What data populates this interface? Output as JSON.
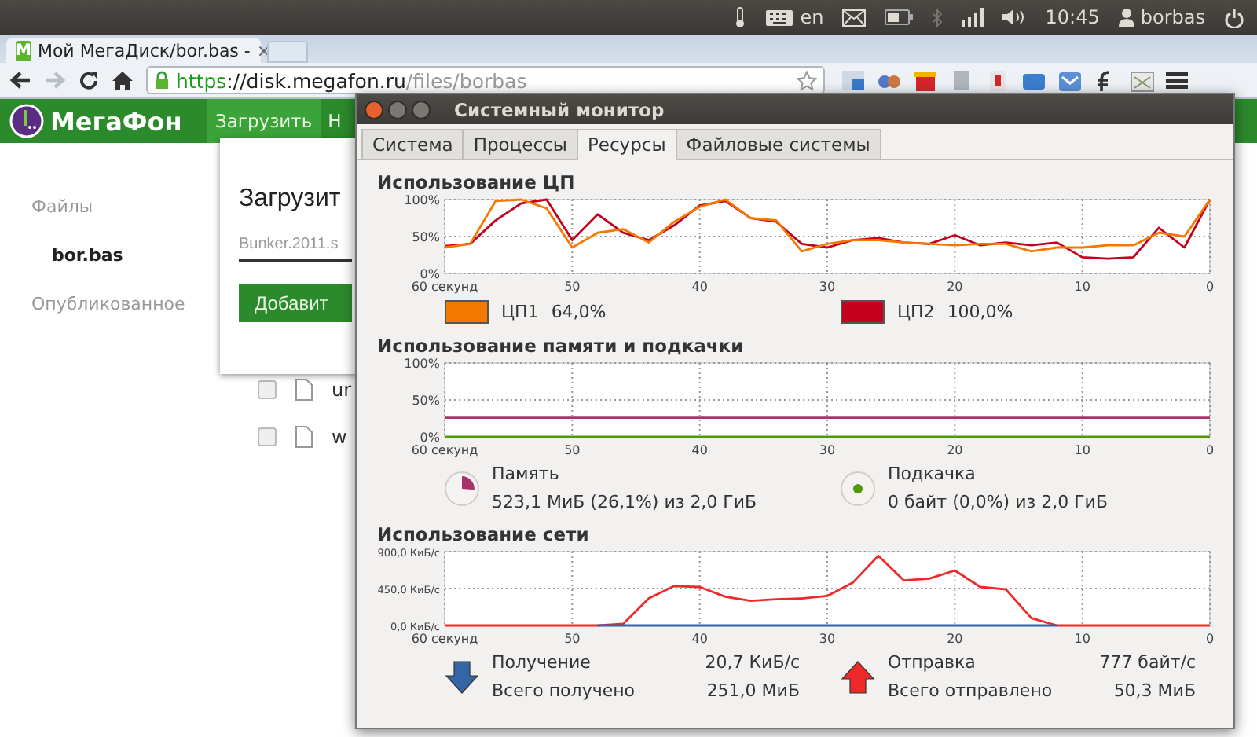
{
  "top_panel": {
    "language": "en",
    "clock": "10:45",
    "user": "borbas"
  },
  "browser": {
    "tab": {
      "favicon": "M",
      "title": "Мой МегаДиск/bor.bas -",
      "close": "×"
    },
    "address": {
      "scheme": "https",
      "host": "://disk.megafon.ru",
      "path": "/files/borbas"
    }
  },
  "site": {
    "logo": "МегаФон",
    "menu": [
      {
        "label": "Загрузить",
        "selected": true
      },
      {
        "label": "Н",
        "selected": false
      }
    ],
    "sidebar": [
      {
        "label": "Файлы",
        "selected": false,
        "children": [
          {
            "label": "bor.bas",
            "selected": true
          }
        ]
      },
      {
        "label": "Опубликованное",
        "selected": false
      }
    ],
    "dialog": {
      "title": "Загрузит",
      "value": "Bunker.2011.s",
      "button": "Добавит"
    },
    "files": [
      {
        "name": "ur",
        "checked": false
      },
      {
        "name": "w",
        "checked": false
      }
    ]
  },
  "window": {
    "title": "Системный монитор",
    "tabs": [
      {
        "label": "Система",
        "selected": false
      },
      {
        "label": "Процессы",
        "selected": false
      },
      {
        "label": "Ресурсы",
        "selected": true
      },
      {
        "label": "Файловые системы",
        "selected": false
      }
    ],
    "cpu": {
      "title": "Использование ЦП",
      "chart_data": {
        "type": "line",
        "grid": true,
        "x": [
          60,
          58,
          56,
          54,
          52,
          50,
          48,
          46,
          44,
          42,
          40,
          38,
          36,
          34,
          32,
          30,
          28,
          26,
          24,
          22,
          20,
          18,
          16,
          14,
          12,
          10,
          8,
          6,
          4,
          2,
          0
        ],
        "xlim": [
          60,
          0
        ],
        "ylim": [
          0,
          100
        ],
        "xticks": [
          {
            "value": 60,
            "label": "60 секунд"
          },
          50,
          40,
          30,
          20,
          10,
          0
        ],
        "yticks": [
          {
            "value": 0,
            "label": "0%"
          },
          {
            "value": 50,
            "label": "50%"
          },
          {
            "value": 100,
            "label": "100%"
          }
        ],
        "series": [
          {
            "name": "ЦП1",
            "color": "#f57900",
            "values": [
              35,
              40,
              98,
              100,
              88,
              35,
              55,
              60,
              42,
              70,
              90,
              100,
              75,
              72,
              30,
              40,
              45,
              45,
              42,
              40,
              38,
              40,
              40,
              30,
              35,
              35,
              38,
              38,
              55,
              50,
              100
            ]
          },
          {
            "name": "ЦП2",
            "color": "#c4001f",
            "values": [
              37,
              40,
              72,
              95,
              100,
              45,
              80,
              55,
              45,
              65,
              92,
              98,
              75,
              70,
              40,
              35,
              45,
              48,
              42,
              40,
              52,
              38,
              42,
              38,
              42,
              22,
              20,
              22,
              62,
              35,
              100
            ]
          }
        ]
      },
      "legend": [
        {
          "reading": "64,0%"
        },
        {
          "reading": "100,0%"
        }
      ]
    },
    "memory": {
      "title": "Использование памяти и подкачки",
      "chart_data": {
        "type": "line",
        "grid": true,
        "x": [
          60,
          0
        ],
        "xlim": [
          60,
          0
        ],
        "ylim": [
          0,
          100
        ],
        "xticks": [
          {
            "value": 60,
            "label": "60 секунд"
          },
          50,
          40,
          30,
          20,
          10,
          0
        ],
        "yticks": [
          {
            "value": 0,
            "label": "0%"
          },
          {
            "value": 50,
            "label": "50%"
          },
          {
            "value": 100,
            "label": "100%"
          }
        ],
        "series": [
          {
            "name": "Память",
            "color": "#a8336b",
            "values": [
              26,
              26
            ]
          },
          {
            "name": "Подкачка",
            "color": "#4e9a06",
            "values": [
              0,
              0
            ]
          }
        ]
      },
      "legend": [
        {
          "kind": "pie",
          "reading": "523,1 МиБ (26,1%) из 2,0 ГиБ"
        },
        {
          "kind": "dot",
          "reading": "0 байт (0,0%) из 2,0 ГиБ"
        }
      ]
    },
    "network": {
      "title": "Использование сети",
      "chart_data": {
        "type": "line",
        "grid": true,
        "x": [
          60,
          58,
          56,
          54,
          52,
          50,
          48,
          46,
          44,
          42,
          40,
          38,
          36,
          34,
          32,
          30,
          28,
          26,
          24,
          22,
          20,
          18,
          16,
          14,
          12,
          10,
          8,
          6,
          4,
          2,
          0
        ],
        "xlim": [
          60,
          0
        ],
        "ylim": [
          0,
          900
        ],
        "xticks": [
          {
            "value": 60,
            "label": "60 секунд"
          },
          50,
          40,
          30,
          20,
          10,
          0
        ],
        "yticks": [
          {
            "value": 0,
            "label": "0,0 КиБ/с"
          },
          {
            "value": 450,
            "label": "450,0 КиБ/с"
          },
          {
            "value": 900,
            "label": "900,0 КиБ/с"
          }
        ],
        "series": [
          {
            "name": "Получение",
            "color": "#3465a4",
            "values": [
              null,
              null,
              null,
              null,
              null,
              null,
              0,
              0,
              0,
              0,
              0,
              0,
              0,
              0,
              0,
              0,
              0,
              0,
              0,
              0,
              0,
              0,
              0,
              0,
              0,
              null,
              null,
              null,
              null,
              null,
              null
            ]
          },
          {
            "name": "Отправка",
            "color": "#ef2929",
            "values": [
              0,
              0,
              0,
              0,
              0,
              0,
              0,
              20,
              330,
              480,
              470,
              350,
              300,
              320,
              330,
              360,
              520,
              850,
              550,
              570,
              670,
              470,
              440,
              90,
              0,
              0,
              0,
              0,
              0,
              0,
              0
            ]
          }
        ]
      },
      "legend": [
        {
          "kind": "down",
          "rate": "20,7 КиБ/с",
          "total_label": "Всего получено",
          "total": "251,0 МиБ"
        },
        {
          "kind": "up",
          "rate": "777 байт/с",
          "total_label": "Всего отправлено",
          "total": "50,3 МиБ"
        }
      ]
    }
  }
}
